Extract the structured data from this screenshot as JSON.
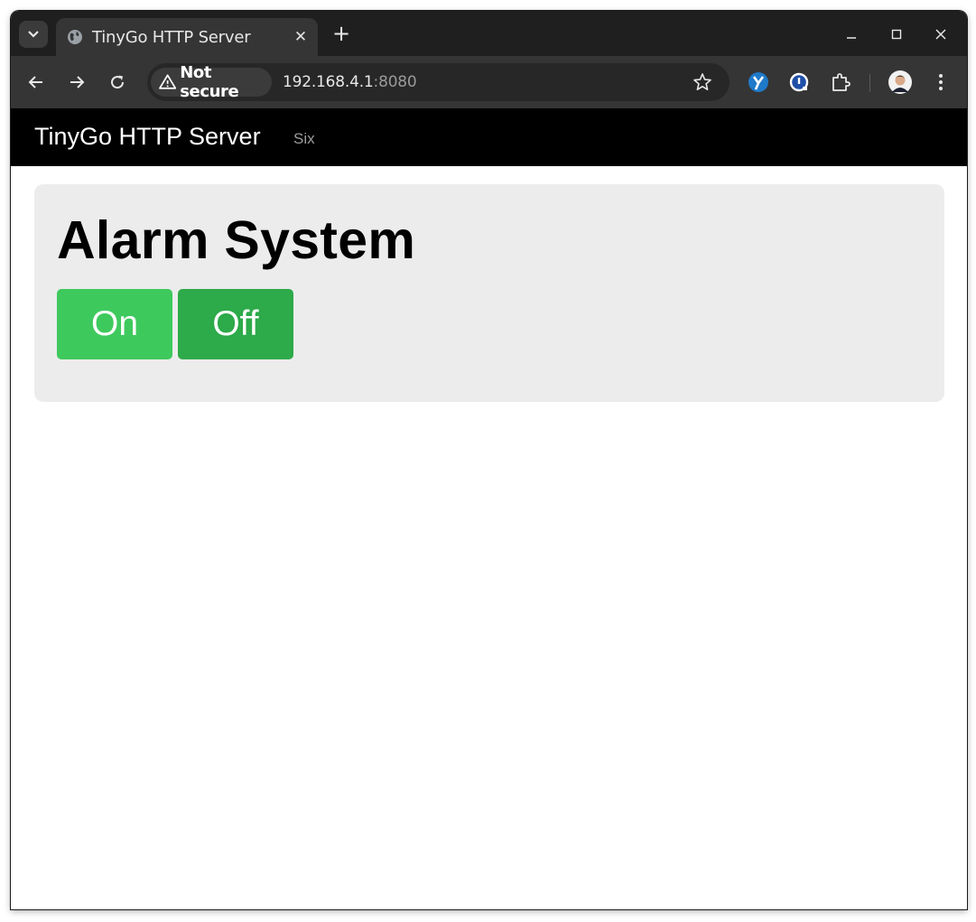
{
  "browser": {
    "tab": {
      "title": "TinyGo HTTP Server"
    },
    "new_tab_label": "+",
    "address": {
      "security_label": "Not secure",
      "host": "192.168.4.1",
      "port": ":8080"
    }
  },
  "page": {
    "navbar": {
      "brand": "TinyGo HTTP Server",
      "link": "Six"
    },
    "heading": "Alarm System",
    "buttons": {
      "on_label": "On",
      "off_label": "Off"
    }
  },
  "colors": {
    "on_button": "#3ec95d",
    "off_button": "#2daa49",
    "jumbotron": "#ececec",
    "navbar": "#000000"
  }
}
